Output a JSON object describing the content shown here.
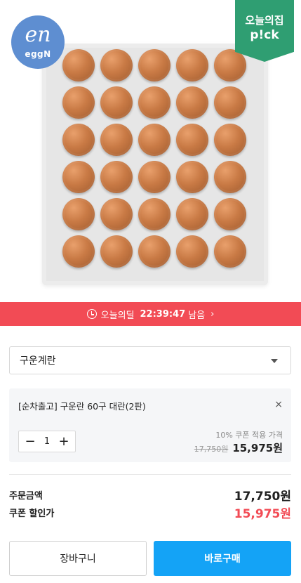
{
  "brand": {
    "mark": "en",
    "name": "eggN",
    "color": "#5e8ed1"
  },
  "ribbon": {
    "line1": "오늘의집",
    "line2": "p!ck",
    "color": "#2f9e72"
  },
  "timer": {
    "icon": "clock-icon",
    "label": "오늘의딜",
    "time": "22:39:47",
    "suffix": "남음",
    "chevron": "›",
    "color": "#f24b55"
  },
  "option_select": {
    "value": "구운계란"
  },
  "selected_option": {
    "name": "[순차출고] 구운란 60구 대란(2판)",
    "close": "×",
    "quantity": "1",
    "minus": "−",
    "plus": "+",
    "coupon_label": "10% 쿠폰 적용 가격",
    "original_price": "17,750원",
    "sale_price": "15,975원"
  },
  "summary": {
    "order_label": "주문금액",
    "order_value": "17,750원",
    "coupon_label": "쿠폰 할인가",
    "coupon_value": "15,975원",
    "coupon_color": "#f24b55"
  },
  "buttons": {
    "cart": "장바구니",
    "buy": "바로구매",
    "buy_color": "#14a3f6"
  }
}
